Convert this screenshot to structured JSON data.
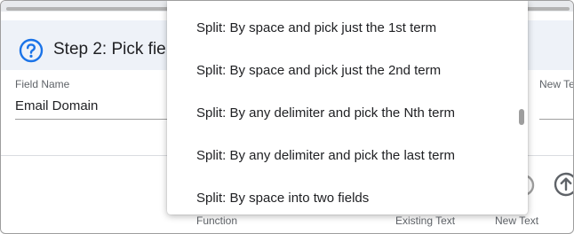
{
  "step": {
    "title": "Step 2: Pick fie"
  },
  "field": {
    "label": "Field Name",
    "value": "Email Domain"
  },
  "right_panel": {
    "new_text_label": "New Te"
  },
  "columns": {
    "function": "Function",
    "existing_text": "Existing Text",
    "new_text": "New Text"
  },
  "dropdown": {
    "items": [
      "Split: By space and pick just the 1st term",
      "Split: By space and pick just the 2nd term",
      "Split: By any delimiter and pick the Nth term",
      "Split: By any delimiter and pick the last term",
      "Split: By space into two fields"
    ]
  },
  "icons": {
    "help": "help-circle-icon",
    "partial_circle": "circle-icon",
    "upload": "arrow-up-circle-icon"
  },
  "colors": {
    "accent_blue": "#1a73e8",
    "header_bg": "#eef2f8",
    "text_primary": "#202124",
    "text_secondary": "#5f6368"
  }
}
